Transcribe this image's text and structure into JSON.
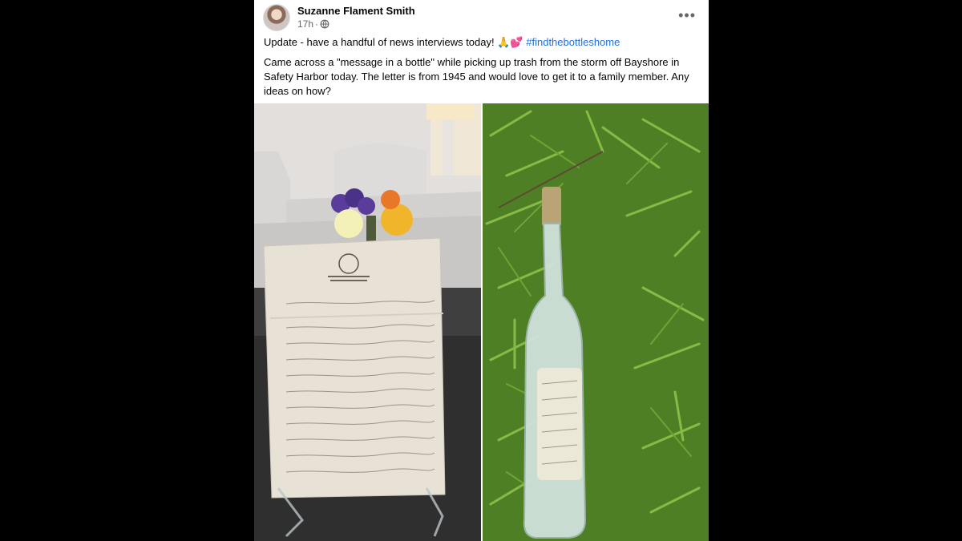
{
  "post": {
    "author": "Suzanne Flament Smith",
    "time": "17h",
    "separator": "·",
    "update_text": "Update - have a handful of news interviews today!",
    "update_emoji": "🙏💕",
    "hashtag": "#findthebottleshome",
    "body": "Came across a \"message in a bottle\" while picking up trash from the storm off Bayshore in Safety Harbor today. The letter is from 1945 and would love to get it to a family member. Any ideas on how?",
    "more_label": "•••",
    "icons": {
      "more": "more-options-icon",
      "privacy": "globe-icon"
    }
  },
  "photos": [
    {
      "subject": "letter-on-stand-photo"
    },
    {
      "subject": "bottle-in-grass-photo"
    }
  ],
  "colors": {
    "page_bg": "#000000",
    "card_bg": "#ffffff",
    "hashtag": "#216fdb",
    "meta_text": "#65676b"
  }
}
